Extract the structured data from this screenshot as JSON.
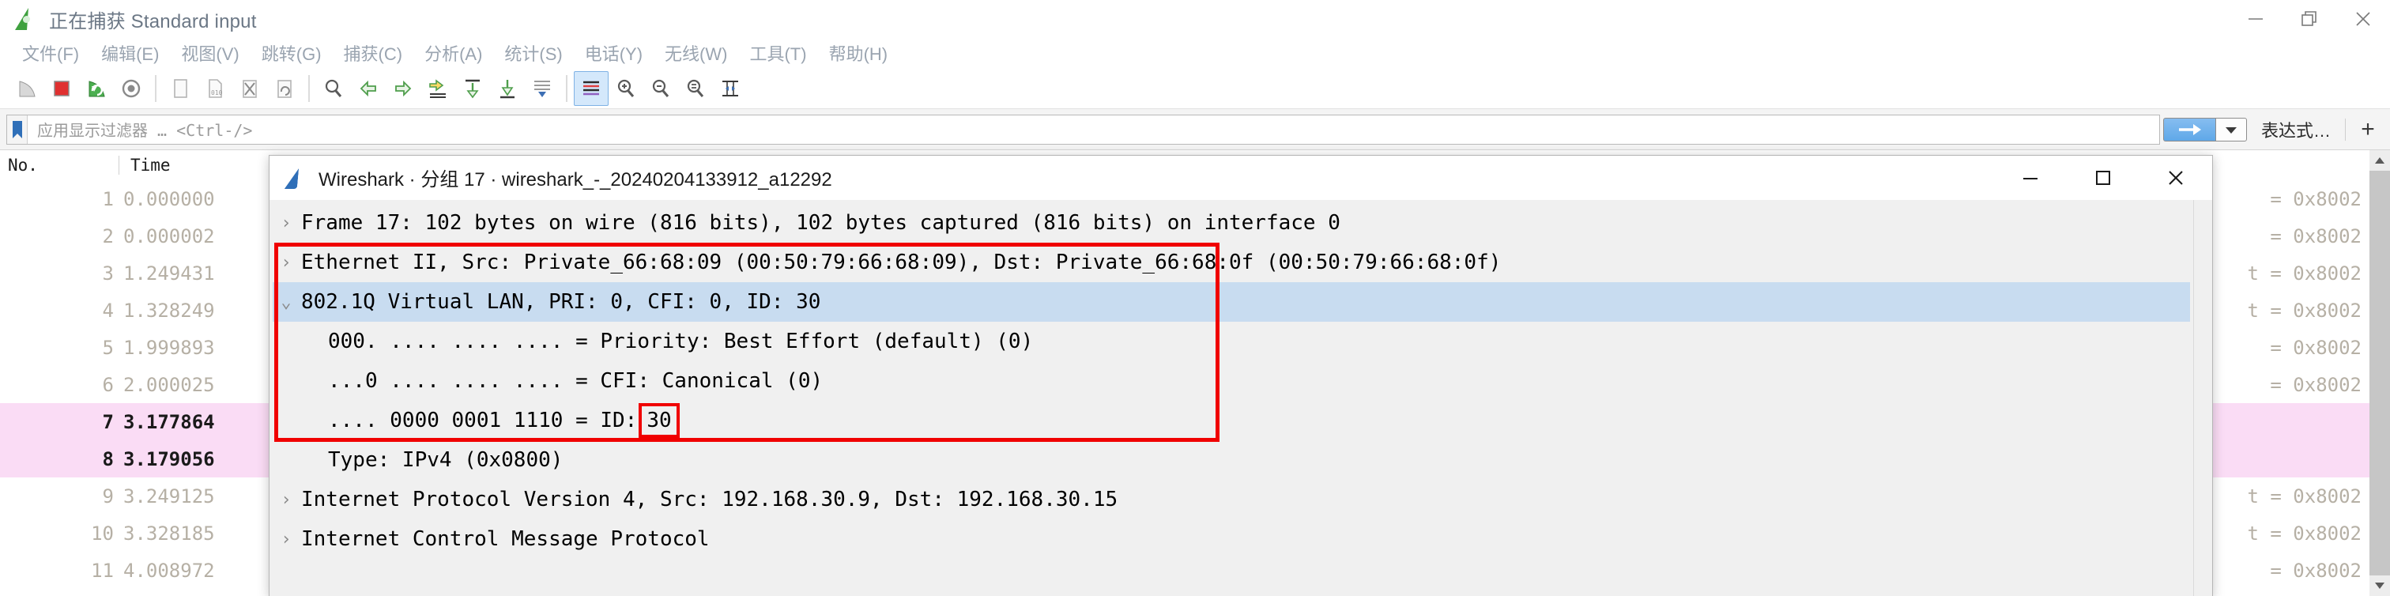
{
  "window": {
    "title": "正在捕获 Standard input",
    "icon": "wireshark-green-icon",
    "controls": {
      "minimize": "minimize-icon",
      "restore": "restore-icon",
      "close": "close-icon"
    }
  },
  "menubar": {
    "items": [
      {
        "label": "文件(F)",
        "name": "menu-file"
      },
      {
        "label": "编辑(E)",
        "name": "menu-edit"
      },
      {
        "label": "视图(V)",
        "name": "menu-view"
      },
      {
        "label": "跳转(G)",
        "name": "menu-go"
      },
      {
        "label": "捕获(C)",
        "name": "menu-capture"
      },
      {
        "label": "分析(A)",
        "name": "menu-analyze"
      },
      {
        "label": "统计(S)",
        "name": "menu-statistics"
      },
      {
        "label": "电话(Y)",
        "name": "menu-telephony"
      },
      {
        "label": "无线(W)",
        "name": "menu-wireless"
      },
      {
        "label": "工具(T)",
        "name": "menu-tools"
      },
      {
        "label": "帮助(H)",
        "name": "menu-help"
      }
    ]
  },
  "toolbar": {
    "buttons": [
      "start-capture-icon",
      "stop-capture-icon",
      "restart-capture-icon",
      "capture-options-icon",
      "separator",
      "open-file-icon",
      "save-file-icon",
      "close-file-icon",
      "reload-file-icon",
      "separator",
      "find-packet-icon",
      "go-back-icon",
      "go-forward-icon",
      "go-to-packet-icon",
      "go-first-packet-icon",
      "go-last-packet-icon",
      "auto-scroll-icon",
      "separator",
      "colorize-icon",
      "zoom-in-icon",
      "zoom-out-icon",
      "zoom-reset-icon",
      "resize-columns-icon"
    ]
  },
  "filterbar": {
    "bookmark_icon": "bookmark-icon",
    "placeholder": "应用显示过滤器 … <Ctrl-/>",
    "value": "",
    "apply_icon": "apply-arrow-icon",
    "dropdown_icon": "chevron-down-icon",
    "expression_label": "表达式…",
    "add_label": "+"
  },
  "packet_list": {
    "columns": [
      {
        "label": "No.",
        "name": "column-no"
      },
      {
        "label": "Time",
        "name": "column-time"
      }
    ],
    "rows": [
      {
        "no": "1",
        "time": "0.000000",
        "tail": "= 0x8002",
        "selected": false
      },
      {
        "no": "2",
        "time": "0.000002",
        "tail": "= 0x8002",
        "selected": false
      },
      {
        "no": "3",
        "time": "1.249431",
        "tail": "t = 0x8002",
        "selected": false
      },
      {
        "no": "4",
        "time": "1.328249",
        "tail": "t = 0x8002",
        "selected": false
      },
      {
        "no": "5",
        "time": "1.999893",
        "tail": "= 0x8002",
        "selected": false
      },
      {
        "no": "6",
        "time": "2.000025",
        "tail": "= 0x8002",
        "selected": false
      },
      {
        "no": "7",
        "time": "3.177864",
        "tail": "",
        "selected": true
      },
      {
        "no": "8",
        "time": "3.179056",
        "tail": "",
        "selected": true
      },
      {
        "no": "9",
        "time": "3.249125",
        "tail": "t = 0x8002",
        "selected": false
      },
      {
        "no": "10",
        "time": "3.328185",
        "tail": "t = 0x8002",
        "selected": false
      },
      {
        "no": "11",
        "time": "4.008972",
        "tail": "= 0x8002",
        "selected": false
      }
    ]
  },
  "dialog": {
    "icon": "wireshark-blue-icon",
    "title": "Wireshark · 分组 17 · wireshark_-_20240204133912_a12292",
    "controls": {
      "minimize": "minimize-icon",
      "maximize": "maximize-icon",
      "close": "close-icon"
    },
    "tree": [
      {
        "label": "Frame 17: 102 bytes on wire (816 bits), 102 bytes captured (816 bits) on interface 0",
        "twisty": "collapsed",
        "indent": 0,
        "selected": false,
        "name": "tree-item-frame"
      },
      {
        "label": "Ethernet II, Src: Private_66:68:09 (00:50:79:66:68:09), Dst: Private_66:68:0f (00:50:79:66:68:0f)",
        "twisty": "collapsed",
        "indent": 0,
        "selected": false,
        "name": "tree-item-ethernet"
      },
      {
        "label": "802.1Q Virtual LAN, PRI: 0, CFI: 0, ID: 30",
        "twisty": "expanded",
        "indent": 0,
        "selected": true,
        "name": "tree-item-vlan"
      },
      {
        "label": "000. .... .... .... = Priority: Best Effort (default) (0)",
        "twisty": "none",
        "indent": 1,
        "selected": false,
        "name": "tree-item-vlan-priority"
      },
      {
        "label": "...0 .... .... .... = CFI: Canonical (0)",
        "twisty": "none",
        "indent": 1,
        "selected": false,
        "name": "tree-item-vlan-cfi"
      },
      {
        "label": ".... 0000 0001 1110 = ID: ",
        "highlight_value": "30",
        "twisty": "none",
        "indent": 1,
        "selected": false,
        "name": "tree-item-vlan-id"
      },
      {
        "label": "Type: IPv4 (0x0800)",
        "twisty": "none",
        "indent": 1,
        "selected": false,
        "name": "tree-item-vlan-type"
      },
      {
        "label": "Internet Protocol Version 4, Src: 192.168.30.9, Dst: 192.168.30.15",
        "twisty": "collapsed",
        "indent": 0,
        "selected": false,
        "name": "tree-item-ipv4"
      },
      {
        "label": "Internet Control Message Protocol",
        "twisty": "collapsed",
        "indent": 0,
        "selected": false,
        "name": "tree-item-icmp"
      }
    ],
    "annotation": {
      "box_color": "#f00000"
    }
  },
  "colors": {
    "selection_blue": "#c8dcf0",
    "marked_pink": "#fadcf5",
    "annotation_red": "#f00000",
    "accent_blue": "#5fa8e8"
  }
}
